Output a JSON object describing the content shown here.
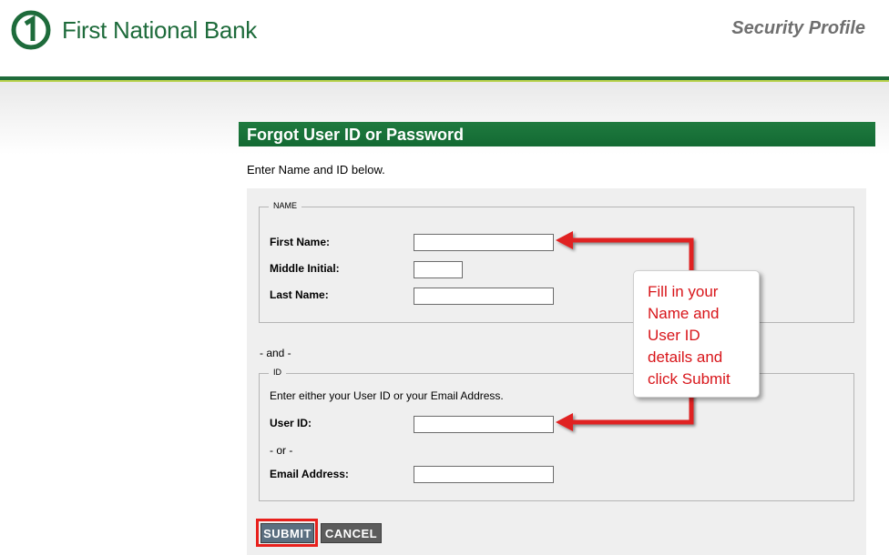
{
  "header": {
    "bank_name": "First National Bank",
    "page_title": "Security Profile"
  },
  "form": {
    "heading": "Forgot User ID or Password",
    "intro": "Enter Name and ID below.",
    "name_section": {
      "legend": "NAME",
      "first_name_label": "First Name:",
      "first_name_value": "",
      "middle_initial_label": "Middle Initial:",
      "middle_initial_value": "",
      "last_name_label": "Last Name:",
      "last_name_value": ""
    },
    "and_text": "- and -",
    "id_section": {
      "legend": "ID",
      "instruction": "Enter either your User ID or your Email Address.",
      "user_id_label": "User ID:",
      "user_id_value": "",
      "or_text": "- or -",
      "email_label": "Email Address:",
      "email_value": ""
    },
    "submit_label": "SUBMIT",
    "cancel_label": "CANCEL"
  },
  "annotation": {
    "lines": [
      "Fill in your",
      "Name and",
      "User ID",
      "details and",
      "click Submit"
    ],
    "color": "#d8151a"
  },
  "colors": {
    "brand_green": "#1e6b3b",
    "accent_lime": "#b9d24c",
    "highlight_red": "#e8201c"
  }
}
